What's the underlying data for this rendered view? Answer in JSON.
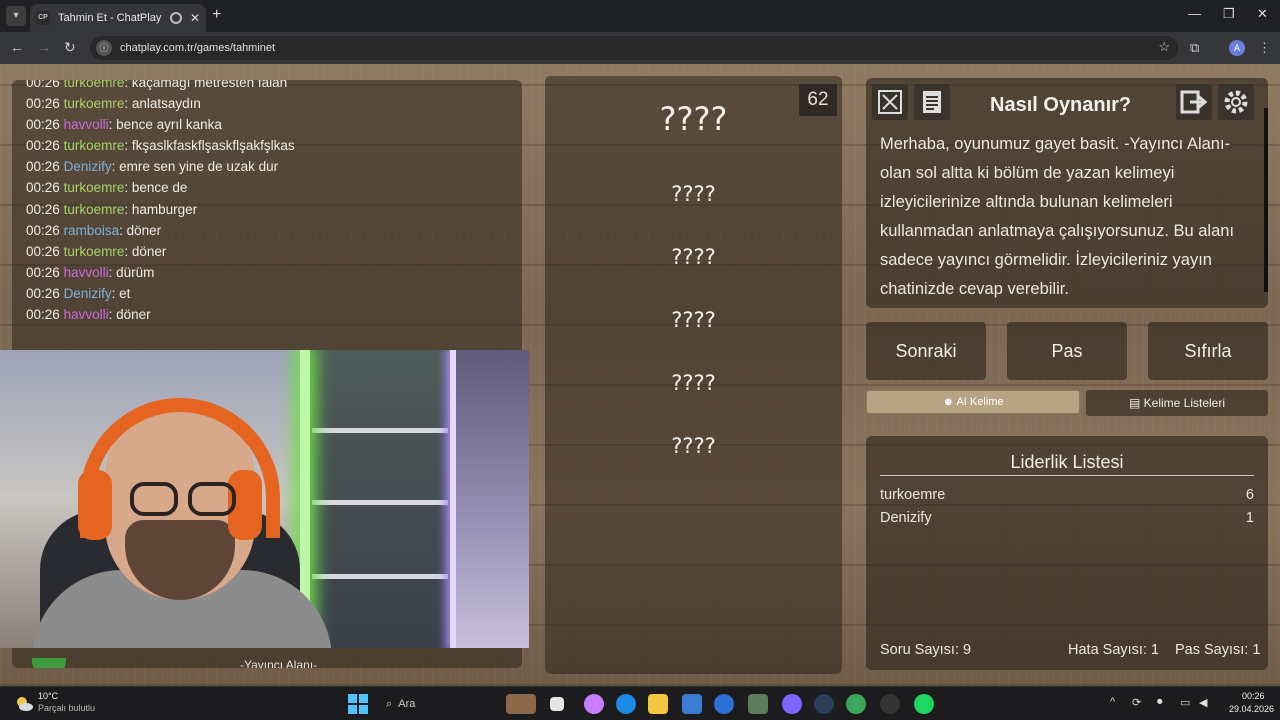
{
  "browser": {
    "tab_title": "Tahmin Et - ChatPlay",
    "tab_favicon": "CP",
    "url": "chatplay.com.tr/games/tahminet",
    "profile_initial": "A"
  },
  "chat": {
    "messages": [
      {
        "time": "00:26",
        "user": "turkoemre",
        "color": "#a8d36a",
        "text": ": kaçamağı metresten falan"
      },
      {
        "time": "00:26",
        "user": "turkoemre",
        "color": "#a8d36a",
        "text": ": anlatsaydın"
      },
      {
        "time": "00:26",
        "user": "havvolli",
        "color": "#c86cd8",
        "text": ": bence ayrıl kanka"
      },
      {
        "time": "00:26",
        "user": "turkoemre",
        "color": "#a8d36a",
        "text": ": fkşaslkfaskflşaskflşakfşlkas"
      },
      {
        "time": "00:26",
        "user": "Denizify",
        "color": "#7fb0d8",
        "text": ": emre sen yine de uzak dur"
      },
      {
        "time": "00:26",
        "user": "turkoemre",
        "color": "#a8d36a",
        "text": ": bence de"
      },
      {
        "time": "00:26",
        "user": "turkoemre",
        "color": "#a8d36a",
        "text": ": hamburger"
      },
      {
        "time": "00:26",
        "user": "ramboisa",
        "color": "#7fb0d8",
        "text": ": döner"
      },
      {
        "time": "00:26",
        "user": "turkoemre",
        "color": "#a8d36a",
        "text": ": döner"
      },
      {
        "time": "00:26",
        "user": "havvolli",
        "color": "#c86cd8",
        "text": ": dürüm"
      },
      {
        "time": "00:26",
        "user": "Denizify",
        "color": "#7fb0d8",
        "text": ": et"
      },
      {
        "time": "00:26",
        "user": "havvolli",
        "color": "#c86cd8",
        "text": ": döner"
      }
    ],
    "streamer_label": "-Yayıncı Alanı-"
  },
  "game": {
    "timer": "62",
    "main_word": "????",
    "forbidden_words": [
      "????",
      "????",
      "????",
      "????",
      "????"
    ]
  },
  "howto": {
    "title": "Nasıl Oynanır?",
    "text": "Merhaba, oyunumuz gayet basit. -Yayıncı Alanı- olan sol altta ki bölüm de yazan kelimeyi izleyicilerinize altında bulunan kelimeleri kullanmadan anlatmaya çalışıyorsunuz. Bu alanı sadece yayıncı görmelidir. İzleyicileriniz yayın chatinizde cevap verebilir."
  },
  "controls": {
    "next": "Sonraki",
    "pass": "Pas",
    "reset": "Sıfırla",
    "ai_word": "AI Kelime",
    "word_lists": "Kelime Listeleri"
  },
  "leaderboard": {
    "title": "Liderlik Listesi",
    "rows": [
      {
        "name": "turkoemre",
        "score": "6"
      },
      {
        "name": "Denizify",
        "score": "1"
      }
    ],
    "question_count": "Soru Sayısı: 9",
    "error_count": "Hata Sayısı: 1",
    "pass_count": "Pas Sayısı: 1"
  },
  "taskbar": {
    "weather_temp": "10°C",
    "weather_desc": "Parçalı bulutlu",
    "search_placeholder": "Ara",
    "time": "00:26",
    "date": "29.04.2026"
  }
}
